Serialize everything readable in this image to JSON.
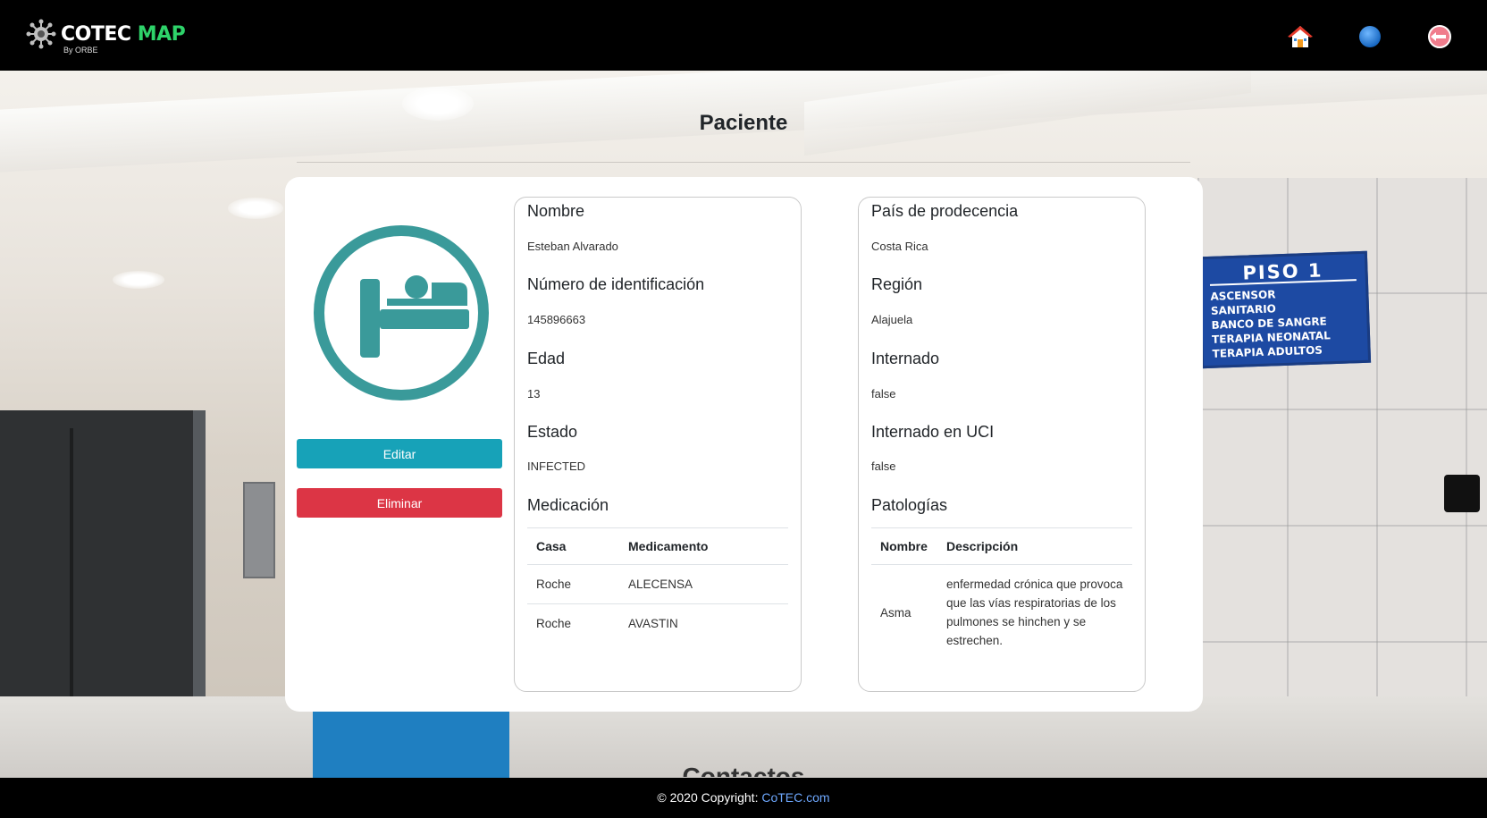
{
  "navbar": {
    "brand_main": "COTEC",
    "brand_accent": "MAP",
    "brand_sub": "By ORBE",
    "accent_color": "#2ed36a",
    "icons": [
      "home-icon",
      "globe-icon",
      "logout-icon"
    ]
  },
  "background_sign": {
    "title": "PISO 1",
    "lines": [
      "ASCENSOR",
      "SANITARIO",
      "BANCO DE SANGRE",
      "TERAPIA NEONATAL",
      "TERAPIA ADULTOS"
    ]
  },
  "page": {
    "title": "Paciente"
  },
  "actions": {
    "edit_label": "Editar",
    "delete_label": "Eliminar",
    "edit_color": "#17a2b8",
    "delete_color": "#dc3545"
  },
  "patient": {
    "nombre_label": "Nombre",
    "nombre": "Esteban Alvarado",
    "id_label": "Número de identificación",
    "id": "145896663",
    "edad_label": "Edad",
    "edad": "13",
    "estado_label": "Estado",
    "estado": "INFECTED",
    "medicacion_label": "Medicación",
    "pais_label": "País de prodecencia",
    "pais": "Costa Rica",
    "region_label": "Región",
    "region": "Alajuela",
    "internado_label": "Internado",
    "internado": "false",
    "uci_label": "Internado en UCI",
    "uci": "false",
    "patologias_label": "Patologías"
  },
  "medication_table": {
    "headers": [
      "Casa",
      "Medicamento"
    ],
    "rows": [
      [
        "Roche",
        "ALECENSA"
      ],
      [
        "Roche",
        "AVASTIN"
      ]
    ]
  },
  "pathology_table": {
    "headers": [
      "Nombre",
      "Descripción"
    ],
    "rows": [
      [
        "Asma",
        "enfermedad crónica que provoca que las vías respiratorias de los pulmones se hinchen y se estrechen."
      ]
    ]
  },
  "contact_heading": "Contactos",
  "footer": {
    "prefix": "© 2020 Copyright:",
    "link": "CoTEC.com"
  }
}
